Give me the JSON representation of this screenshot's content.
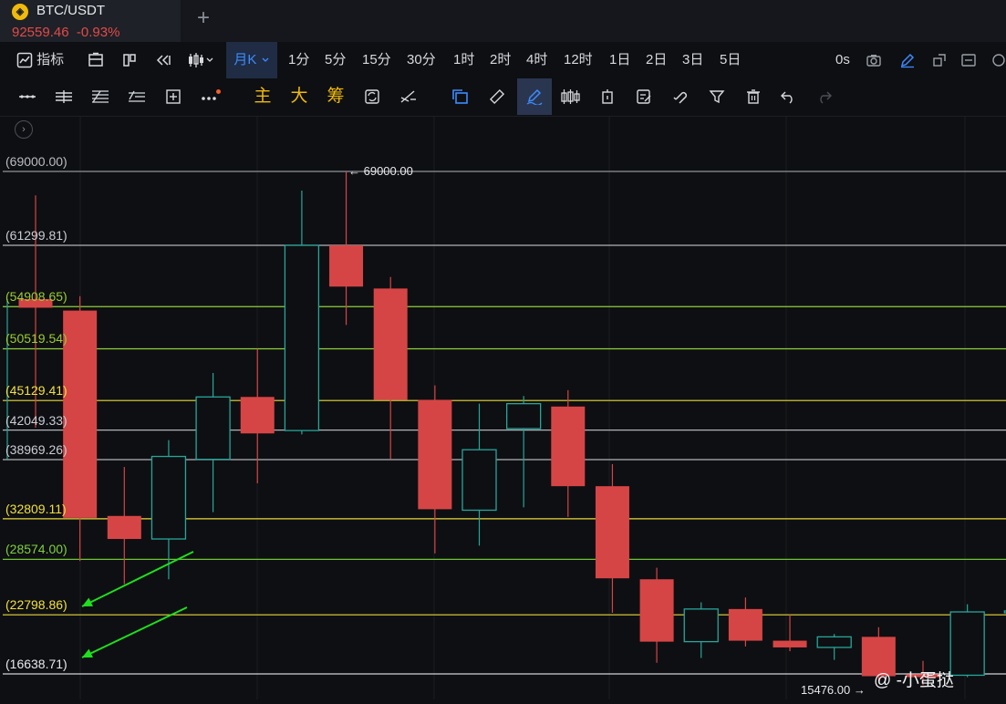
{
  "tab": {
    "coin_glyph": "◈",
    "symbol": "BTC/USDT",
    "price": "92559.46",
    "change": "-0.93%",
    "new_tab": "+"
  },
  "toolbar": {
    "indicators": "指标",
    "interval_selected": "月K",
    "intervals": [
      "1分",
      "5分",
      "15分",
      "30分",
      "1时",
      "2时",
      "4时",
      "12时",
      "1日",
      "2日",
      "3日",
      "5日"
    ],
    "countdown": "0s"
  },
  "drawtools": {
    "main": "主",
    "big": "大",
    "chips": "筹"
  },
  "chart_data": {
    "type": "candlestick",
    "candles": [
      {
        "open": 55700,
        "high": 66500,
        "low": 42300,
        "close": 54800
      },
      {
        "open": 54500,
        "high": 56000,
        "low": 28400,
        "close": 32900
      },
      {
        "open": 33100,
        "high": 38200,
        "low": 26000,
        "close": 30700
      },
      {
        "open": 30700,
        "high": 41000,
        "low": 26500,
        "close": 39300
      },
      {
        "open": 39000,
        "high": 48000,
        "low": 33500,
        "close": 45500
      },
      {
        "open": 45500,
        "high": 50500,
        "low": 36500,
        "close": 41700
      },
      {
        "open": 42000,
        "high": 67000,
        "low": 41600,
        "close": 61300
      },
      {
        "open": 61300,
        "high": 69000,
        "low": 53000,
        "close": 57000
      },
      {
        "open": 56800,
        "high": 58000,
        "low": 39000,
        "close": 45200
      },
      {
        "open": 45200,
        "high": 46700,
        "low": 29200,
        "close": 33800
      },
      {
        "open": 33700,
        "high": 44800,
        "low": 30000,
        "close": 40000
      },
      {
        "open": 42200,
        "high": 45600,
        "low": 34000,
        "close": 44800
      },
      {
        "open": 44500,
        "high": 46200,
        "low": 33000,
        "close": 36200
      },
      {
        "open": 36200,
        "high": 38500,
        "low": 23000,
        "close": 26600
      },
      {
        "open": 26500,
        "high": 27700,
        "low": 17800,
        "close": 20000
      },
      {
        "open": 20000,
        "high": 24100,
        "low": 18300,
        "close": 23400
      },
      {
        "open": 23400,
        "high": 24600,
        "low": 19500,
        "close": 20100
      },
      {
        "open": 20100,
        "high": 22800,
        "low": 19000,
        "close": 19400
      },
      {
        "open": 19400,
        "high": 20800,
        "low": 18100,
        "close": 20500
      },
      {
        "open": 20500,
        "high": 21500,
        "low": 15800,
        "close": 16400
      },
      {
        "open": 16600,
        "high": 18000,
        "low": 15476,
        "close": 16300
      },
      {
        "open": 16500,
        "high": 23900,
        "low": 16300,
        "close": 23100
      },
      {
        "open": 23100,
        "high": 23300,
        "low": 23000,
        "close": 23200
      }
    ],
    "levels": [
      {
        "price": 69000.0,
        "label": "(69000.00)",
        "color": "#b9bcc2",
        "line": "#8f939a"
      },
      {
        "price": 61299.81,
        "label": "(61299.81)",
        "color": "#c9cdd4",
        "line": "#b0b3b8"
      },
      {
        "price": 54908.65,
        "label": "(54908.65)",
        "color": "#9acd32",
        "line": "#8fcf3c"
      },
      {
        "price": 50519.54,
        "label": "(50519.54)",
        "color": "#9acd32",
        "line": "#8fcf3c"
      },
      {
        "price": 45129.41,
        "label": "(45129.41)",
        "color": "#f0e040",
        "line": "#e8d83a"
      },
      {
        "price": 42049.33,
        "label": "(42049.33)",
        "color": "#c9cdd4",
        "line": "#b0b3b8"
      },
      {
        "price": 38969.26,
        "label": "(38969.26)",
        "color": "#c9cdd4",
        "line": "#b0b3b8"
      },
      {
        "price": 32809.11,
        "label": "(32809.11)",
        "color": "#f0e040",
        "line": "#e8d83a"
      },
      {
        "price": 28574.0,
        "label": "(28574.00)",
        "color": "#7fd040",
        "line": "#6fc235"
      },
      {
        "price": 22798.86,
        "label": "(22798.86)",
        "color": "#f0e040",
        "line": "#e8d83a"
      },
      {
        "price": 16638.71,
        "label": "(16638.71)",
        "color": "#e6e8ec",
        "line": "#d0d2d6"
      }
    ],
    "high_marker": "69000.00",
    "low_marker": "15476.00",
    "colors": {
      "up": "#26a69a",
      "down": "#d64545",
      "arrow": "#1ee01e"
    }
  },
  "watermark": "@ -小蛋挞"
}
